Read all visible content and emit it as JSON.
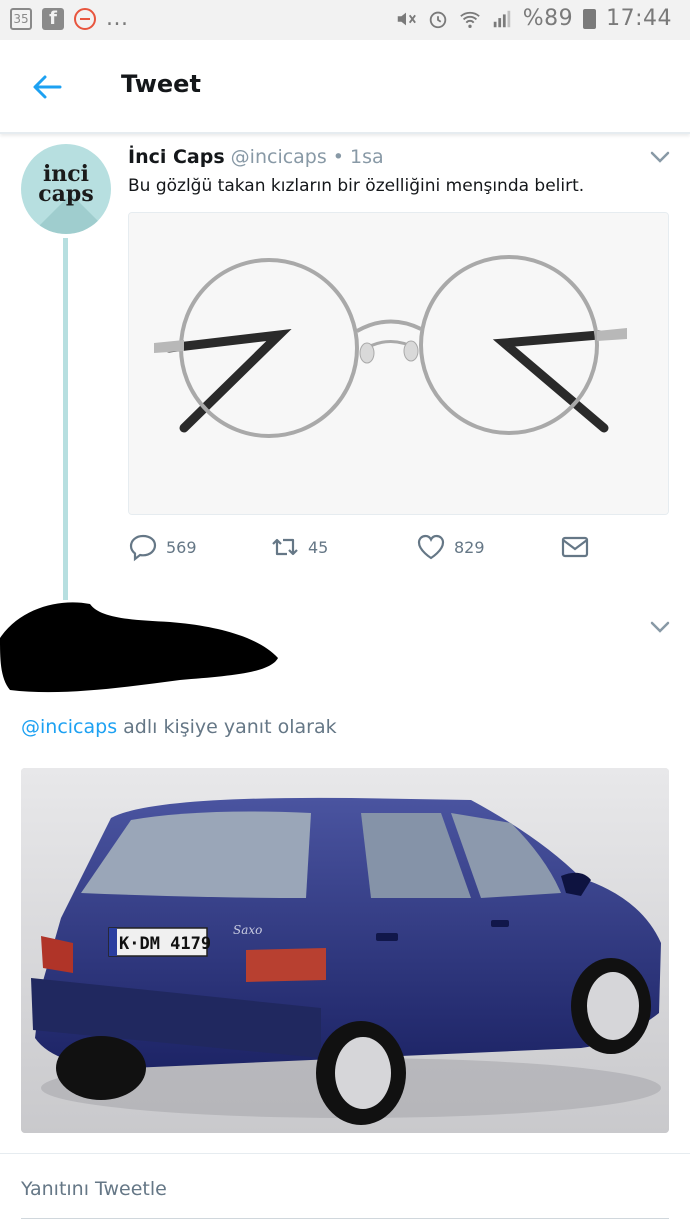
{
  "status_bar": {
    "left_icons": [
      "gallery-icon",
      "facebook-icon",
      "blocked-icon"
    ],
    "ellipsis": "...",
    "right_icons": [
      "mute-icon",
      "alarm-icon",
      "wifi-icon",
      "signal-icon",
      "battery-icon"
    ],
    "battery": "%89",
    "time": "17:44"
  },
  "header": {
    "title": "Tweet",
    "back_icon": "back-arrow-icon"
  },
  "tweet": {
    "avatar_text": "inci caps",
    "name": "İnci Caps",
    "handle": "@incicaps",
    "separator": "•",
    "time": "1sa",
    "text": "Bu gözlğü takan kızların bir özelliğini menşında belirt.",
    "media_description_icon": "glasses-photo",
    "actions": {
      "reply_count": "569",
      "retweet_count": "45",
      "like_count": "829"
    }
  },
  "reply": {
    "reply_prefix_mention": "@incicaps",
    "reply_suffix": " adlı kişiye yanıt olarak",
    "media_icon": "car-photo",
    "license_plate": "K·DM 4179",
    "car_badge": "Saxo"
  },
  "composer": {
    "placeholder": "Yanıtını Tweetle"
  },
  "colors": {
    "accent": "#1da1f2",
    "muted": "#657786",
    "avatar_bg": "#b7dfe0"
  }
}
